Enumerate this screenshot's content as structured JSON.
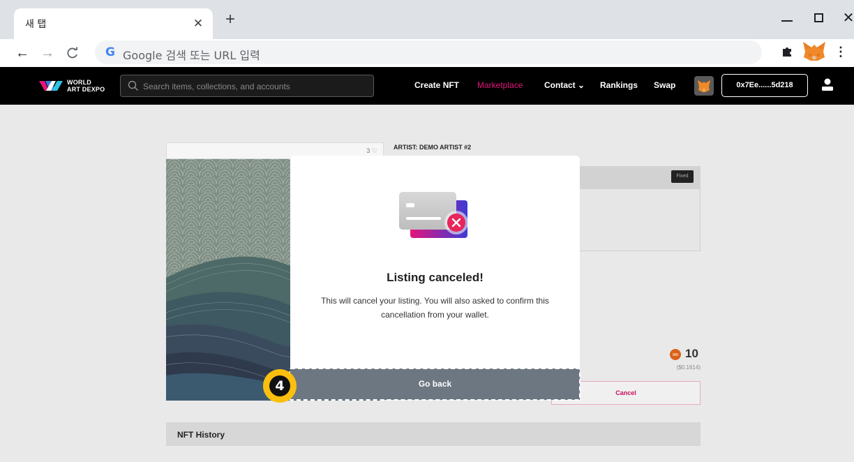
{
  "browser": {
    "tab_title": "새 탭",
    "tab_close": "✕",
    "new_tab": "+",
    "nav_back": "←",
    "nav_forward": "→",
    "nav_reload": "C",
    "google_letter": "G",
    "address_placeholder": "Google 검색 또는 URL 입력",
    "window_close": "✕",
    "extension_icon": "puzzle-icon",
    "menu_icon": "⋮"
  },
  "site": {
    "logo_line1": "WORLD",
    "logo_line2": "ART DEXPO",
    "search_placeholder": "Search items, collections, and accounts",
    "nav": {
      "create": "Create NFT",
      "marketplace": "Marketplace",
      "contact": "Contact ⌄",
      "rankings": "Rankings",
      "swap": "Swap"
    },
    "wallet_address": "0x7Ee......5d218",
    "colors": {
      "header_bg": "#000000",
      "active_nav": "#e4157b"
    }
  },
  "listing": {
    "like_count": "3 ♡",
    "artist": "ARTIST: DEMO ARTIST #2",
    "sale_type_badge": "Fixed",
    "price": "10",
    "price_usd": "($0.1614)",
    "cancel_label": "Cancel",
    "history_label": "NFT History"
  },
  "modal": {
    "title": "Listing canceled!",
    "message": "This will cancel your listing. You will also asked to confirm this cancellation from your wallet.",
    "button_label": "Go back",
    "button_color": "#6c7782"
  },
  "annotation": {
    "step_number": "4",
    "badge_color": "#fbbf0f"
  }
}
